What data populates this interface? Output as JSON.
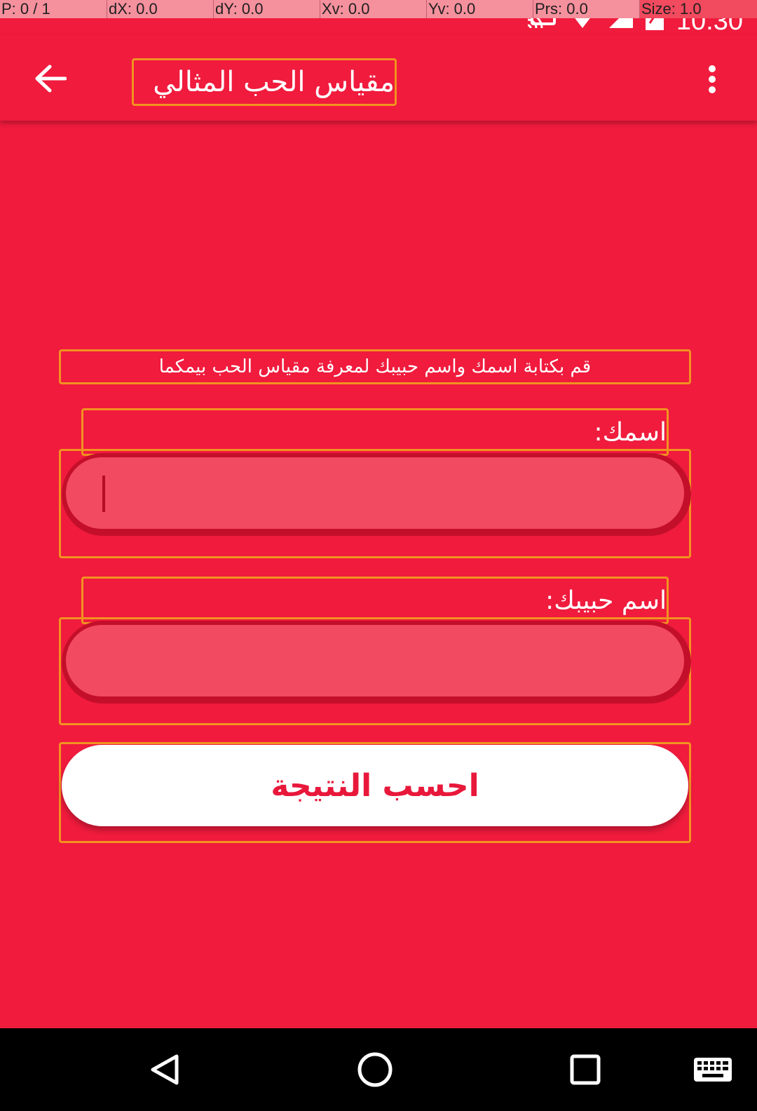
{
  "debug": {
    "p": "P: 0 / 1",
    "dx": "dX: 0.0",
    "dy": "dY: 0.0",
    "xv": "Xv: 0.0",
    "yv": "Yv: 0.0",
    "prs": "Prs: 0.0",
    "size": "Size: 1.0"
  },
  "status_bar": {
    "time": "10:30",
    "icons": [
      "cast-icon",
      "wifi-icon",
      "signal-icon",
      "battery-icon"
    ]
  },
  "app_bar": {
    "title": "مقياس الحب المثالي",
    "back_icon": "arrow-back-icon",
    "menu_icon": "more-vert-icon"
  },
  "form": {
    "instructions": "قم بكتابة اسمك واسم حبيبك لمعرفة مقياس الحب بيمكما",
    "name_label": "اسمك:",
    "name_value": "",
    "beloved_label": "اسم حبيبك:",
    "beloved_value": "",
    "submit_label": "احسب النتيجة"
  },
  "nav_bar": {
    "icons": [
      "back-triangle-icon",
      "home-circle-icon",
      "recents-square-icon",
      "keyboard-icon"
    ]
  },
  "colors": {
    "background": "#F01B3D",
    "input_fill": "#F24A60",
    "button_text": "#E8183B",
    "outline": "#F29220"
  }
}
